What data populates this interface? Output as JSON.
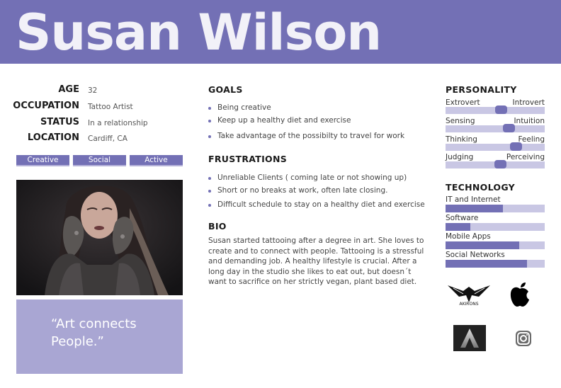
{
  "persona": {
    "name": "Susan Wilson"
  },
  "info": [
    {
      "label": "AGE",
      "value": "32"
    },
    {
      "label": "OCCUPATION",
      "value": "Tattoo Artist"
    },
    {
      "label": "STATUS",
      "value": "In a relationship"
    },
    {
      "label": "LOCATION",
      "value": "Cardiff, CA"
    }
  ],
  "tags": [
    "Creative",
    "Social",
    "Active"
  ],
  "quote": "“Art connects People.”",
  "goals": {
    "title": "GOALS",
    "items": [
      "Being creative",
      "Keep up a healthy diet and exercise",
      "Take advantage of the possibilty to travel for work"
    ]
  },
  "frustrations": {
    "title": "FRUSTRATIONS",
    "items": [
      "Unreliable Clients ( coming late or not showing up)",
      "Short or no breaks at work, often late closing.",
      "Difficult schedule to stay on a healthy diet and exercise"
    ]
  },
  "bio": {
    "title": "BIO",
    "text": "Susan started tattooing after a degree in art. She loves to create and to connect with people. Tattooing is a stressful and demanding job. A healthy lifestyle is crucial. After a long day in the studio she likes to eat out, but doesn´t want to sacrifice on her strictly vegan, plant based diet."
  },
  "personality": {
    "title": "PERSONALITY",
    "traits": [
      {
        "left": "Extrovert",
        "right": "Introvert",
        "level": 0.56
      },
      {
        "left": "Sensing",
        "right": "Intuition",
        "level": 0.64
      },
      {
        "left": "Thinking",
        "right": "Feeling",
        "level": 0.71
      },
      {
        "left": "Judging",
        "right": "Perceiving",
        "level": 0.55
      }
    ]
  },
  "technology": {
    "title": "TECHNOLOGY",
    "items": [
      {
        "label": "IT and Internet",
        "level": 0.58
      },
      {
        "label": "Software",
        "level": 0.25
      },
      {
        "label": "Mobile Apps",
        "level": 0.74
      },
      {
        "label": "Social Networks",
        "level": 0.82
      }
    ]
  },
  "brands": {
    "logo1_text": "AKIRONS",
    "icons": [
      "akirons-logo-icon",
      "apple-logo-icon",
      "artstation-logo-icon",
      "instagram-logo-icon"
    ]
  },
  "colors": {
    "accent": "#7370b5",
    "light": "#c9c7e4",
    "quote_bg": "#a9a6d3"
  }
}
